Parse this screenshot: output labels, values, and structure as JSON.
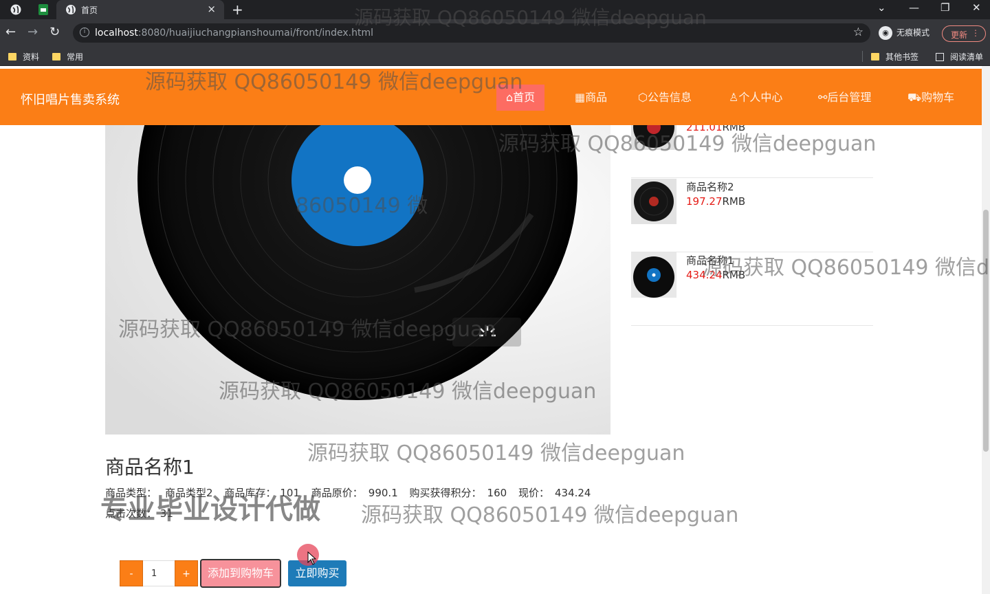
{
  "browser": {
    "tab_title": "首页",
    "url_host": "localhost",
    "url_path": ":8080/huaijiuchangpianshoumai/front/index.html",
    "profile_label": "无痕模式",
    "update_label": "更新",
    "bookmarks": [
      "资料",
      "常用"
    ],
    "bookmarks_right": [
      "其他书签",
      "阅读清单"
    ]
  },
  "site": {
    "title": "怀旧唱片售卖系统",
    "nav": [
      {
        "label": "首页",
        "icon": "home-icon"
      },
      {
        "label": "商品",
        "icon": "grid-icon"
      },
      {
        "label": "公告信息",
        "icon": "cube-icon"
      },
      {
        "label": "个人中心",
        "icon": "user-icon"
      },
      {
        "label": "后台管理",
        "icon": "link-icon"
      },
      {
        "label": "购物车",
        "icon": "cart-icon"
      }
    ]
  },
  "recommend": [
    {
      "name": "",
      "price": "211.01",
      "unit": "RMB"
    },
    {
      "name": "商品名称2",
      "price": "197.27",
      "unit": "RMB"
    },
    {
      "name": "商品名称1",
      "price": "434.24",
      "unit": "RMB"
    }
  ],
  "product": {
    "title": "商品名称1",
    "category_label": "商品类型：",
    "category": "商品类型2",
    "stock_label": "商品库存：",
    "stock": "101",
    "orig_price_label": "商品原价：",
    "orig_price": "990.1",
    "points_label": "购买获得积分：",
    "points": "160",
    "price_label": "现价：",
    "price": "434.24",
    "clicks_label": "点击次数：",
    "clicks": "31"
  },
  "purchase": {
    "minus": "-",
    "quantity": "1",
    "plus": "+",
    "add_cart": "添加到购物车",
    "buy_now": "立即购买"
  },
  "watermarks": {
    "repeat": "源码获取 QQ86050149 微信deepguan",
    "partial_a": "86050149 微",
    "partial_b": "QQ86050149 微信deepguan",
    "overlay": "专业毕业设计代做"
  }
}
